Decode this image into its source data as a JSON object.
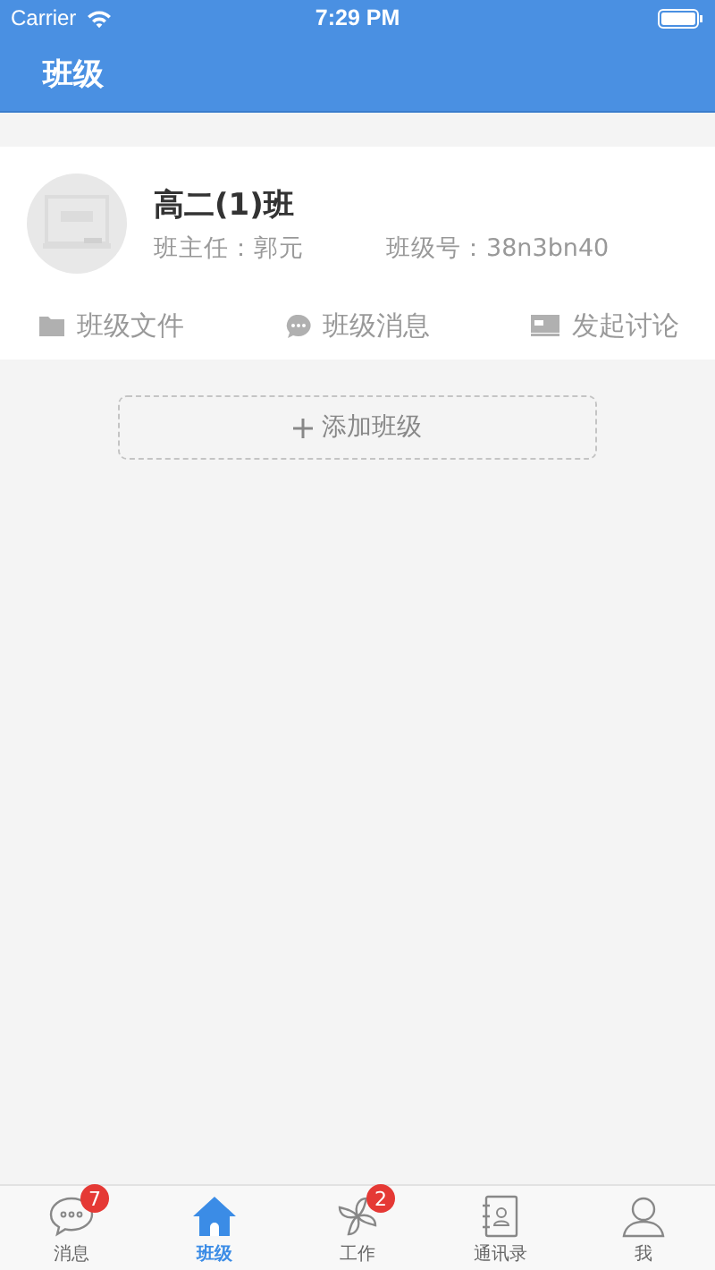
{
  "status_bar": {
    "carrier": "Carrier",
    "time": "7:29 PM"
  },
  "nav": {
    "title": "班级"
  },
  "class_card": {
    "name": "高二(1)班",
    "teacher": "班主任：郭元",
    "class_id": "班级号：38n3bn40",
    "actions": [
      {
        "kind": "folder",
        "label": "班级文件"
      },
      {
        "kind": "chat",
        "label": "班级消息"
      },
      {
        "kind": "board",
        "label": "发起讨论"
      }
    ]
  },
  "add_button": {
    "label": "添加班级"
  },
  "tab_bar": [
    {
      "kind": "messages",
      "label": "消息",
      "badge": "7",
      "selected": false
    },
    {
      "kind": "home",
      "label": "班级",
      "selected": true
    },
    {
      "kind": "pinwheel",
      "label": "工作",
      "badge": "2",
      "selected": false
    },
    {
      "kind": "contacts",
      "label": "通讯录",
      "selected": false
    },
    {
      "kind": "person",
      "label": "我",
      "selected": false
    }
  ]
}
